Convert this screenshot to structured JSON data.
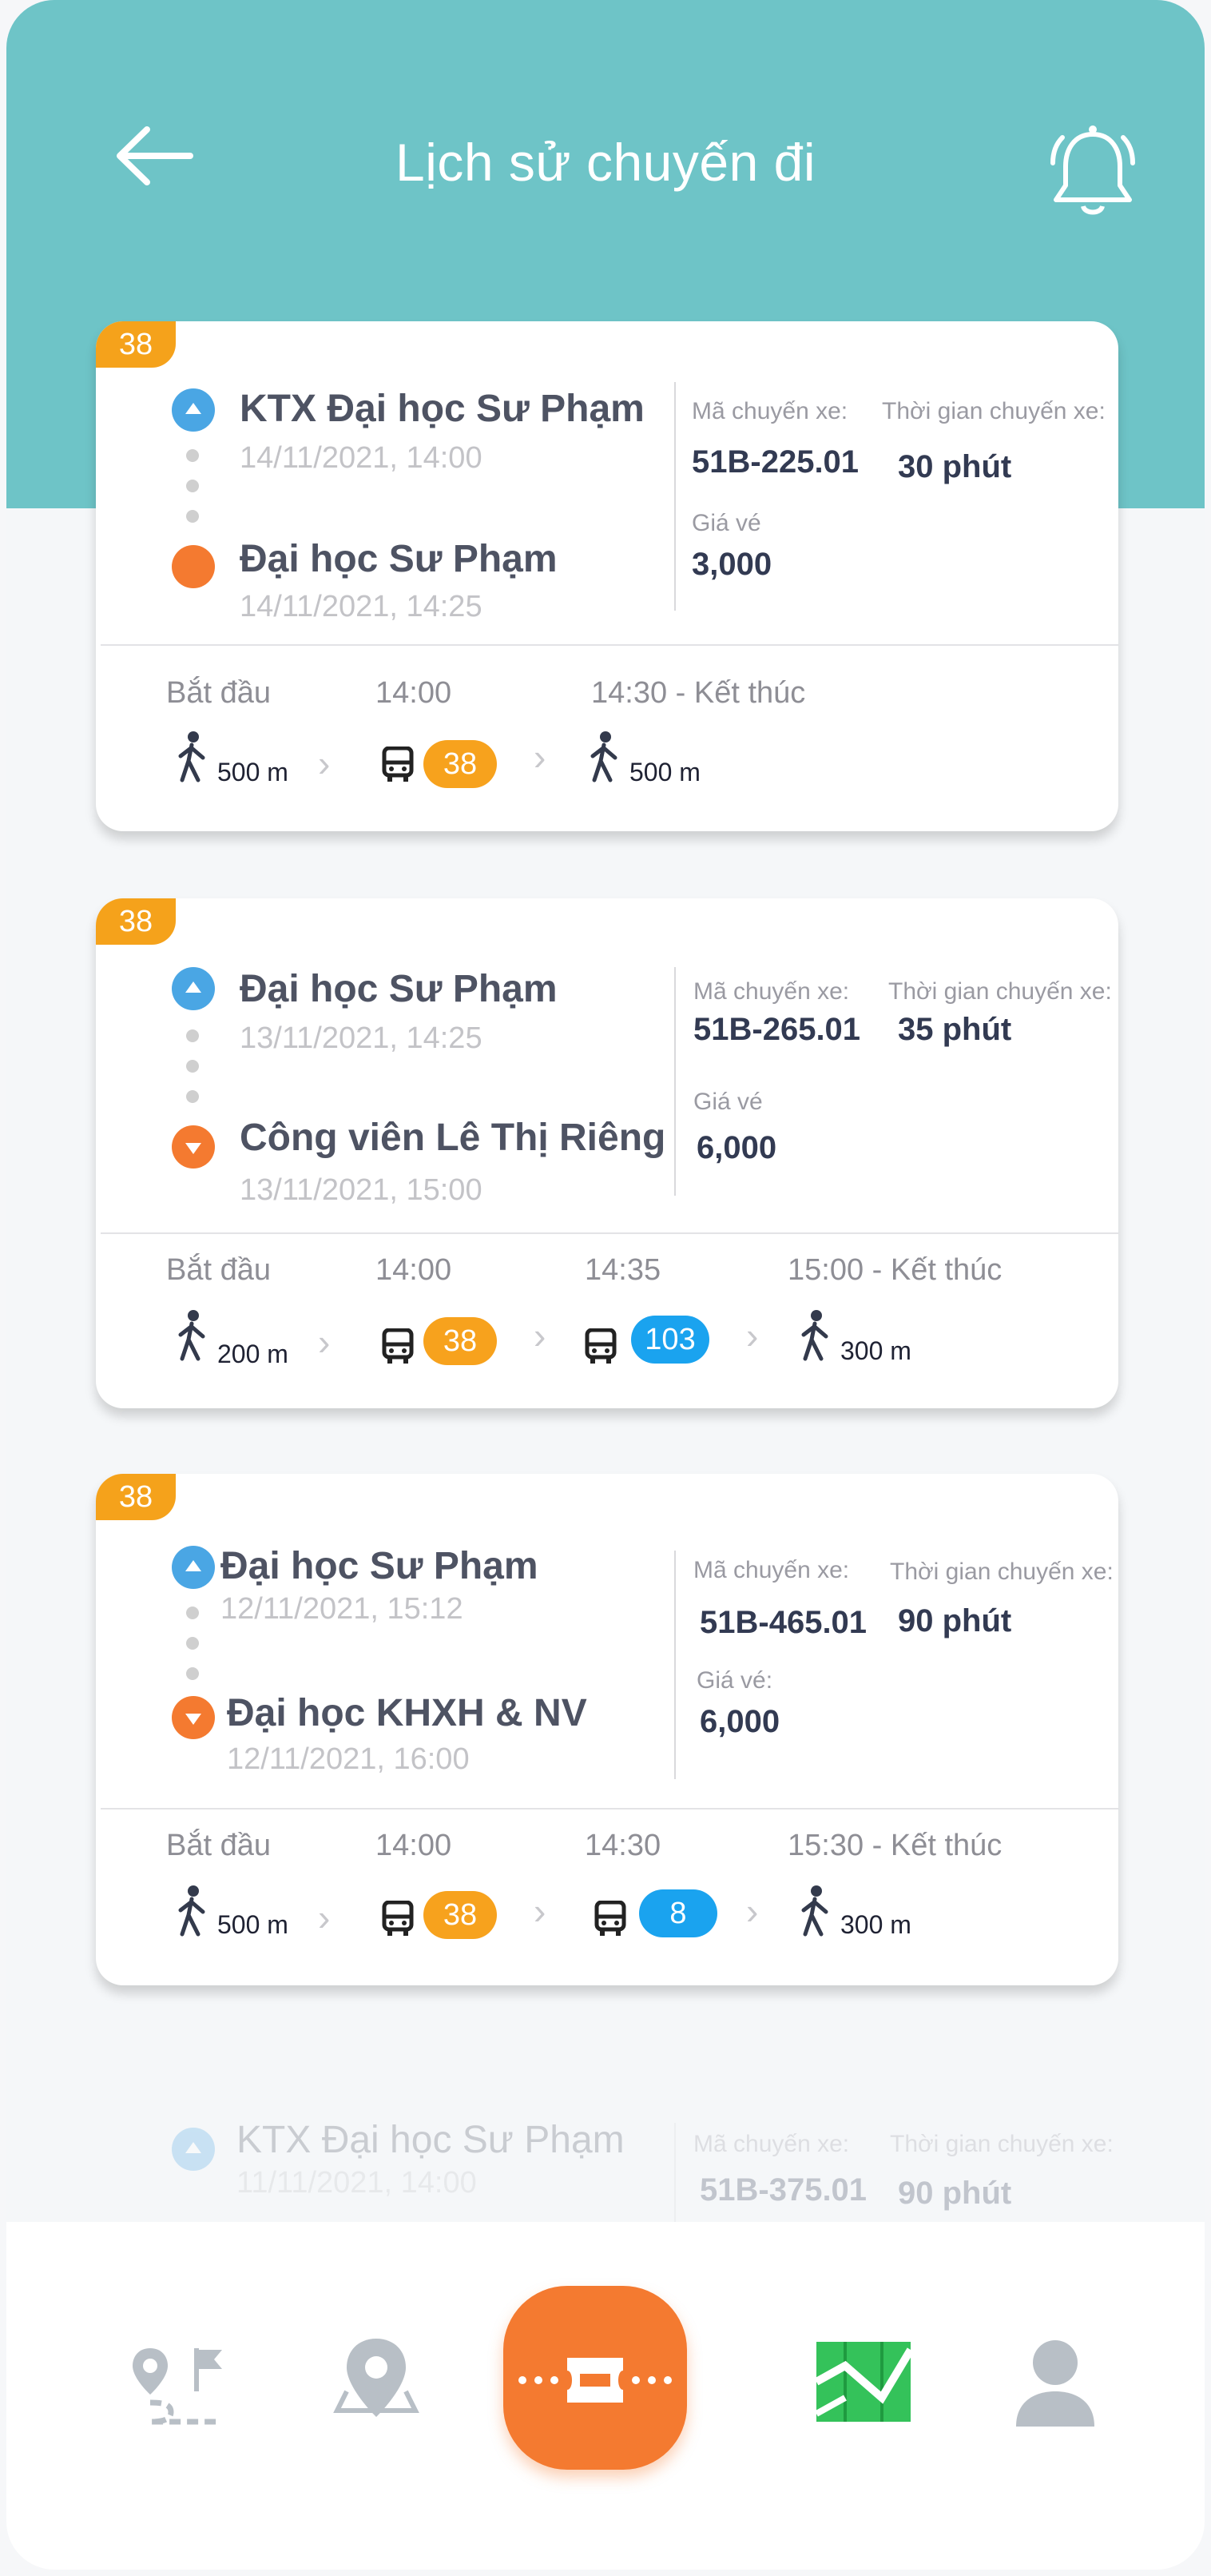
{
  "header": {
    "title": "Lịch sử chuyến đi",
    "back_icon": "arrow-left-icon",
    "bell_icon": "bell-icon",
    "bg_color": "#6ec4c7"
  },
  "trips": [
    {
      "route_tag": "38",
      "from": {
        "name": "KTX Đại học Sư Phạm",
        "time": "14/11/2021, 14:00"
      },
      "to": {
        "name": "Đại học Sư Phạm",
        "time": "14/11/2021, 14:25"
      },
      "vehicle_code_label": "Mã chuyến xe:",
      "vehicle_code": "51B-225.01",
      "duration_label": "Thời gian chuyến xe:",
      "duration": "30 phút",
      "price_label": "Giá vé",
      "price": "3,000",
      "timeline": {
        "t1": "Bắt đầu",
        "t2": "14:00",
        "t3": "14:30 - Kết thúc",
        "walk1": "500 m",
        "bus1": "38",
        "walk2": "500 m"
      }
    },
    {
      "route_tag": "38",
      "from": {
        "name": "Đại học Sư Phạm",
        "time": "13/11/2021, 14:25"
      },
      "to": {
        "name": "Công viên Lê Thị Riêng",
        "time": "13/11/2021, 15:00"
      },
      "vehicle_code_label": "Mã chuyến xe:",
      "vehicle_code": "51B-265.01",
      "duration_label": "Thời gian chuyến xe:",
      "duration": "35 phút",
      "price_label": "Giá vé",
      "price": "6,000",
      "timeline": {
        "t1": "Bắt đầu",
        "t2": "14:00",
        "t3": "14:35",
        "t4": "15:00 - Kết thúc",
        "walk1": "200 m",
        "bus1": "38",
        "bus2": "103",
        "walk2": "300 m"
      }
    },
    {
      "route_tag": "38",
      "from": {
        "name": "Đại học Sư Phạm",
        "time": "12/11/2021, 15:12"
      },
      "to": {
        "name": "Đại học KHXH & NV",
        "time": "12/11/2021, 16:00"
      },
      "vehicle_code_label": "Mã chuyến xe:",
      "vehicle_code": "51B-465.01",
      "duration_label": "Thời gian chuyến xe:",
      "duration": "90 phút",
      "price_label": "Giá vé:",
      "price": "6,000",
      "timeline": {
        "t1": "Bắt đầu",
        "t2": "14:00",
        "t3": "14:30",
        "t4": "15:30 - Kết thúc",
        "walk1": "500 m",
        "bus1": "38",
        "bus2": "8",
        "walk2": "300 m"
      }
    },
    {
      "from": {
        "name": "KTX Đại học Sư Phạm",
        "time": "11/11/2021, 14:00"
      },
      "vehicle_code_label": "Mã chuyến xe:",
      "vehicle_code": "51B-375.01",
      "duration_label": "Thời gian chuyến xe:",
      "duration": "90 phút"
    }
  ],
  "bottom_nav": {
    "items": [
      "route-icon",
      "map-pin-icon",
      "ticket-icon",
      "map-icon",
      "profile-icon"
    ],
    "active": "ticket-icon",
    "accent": "#f47a30"
  }
}
